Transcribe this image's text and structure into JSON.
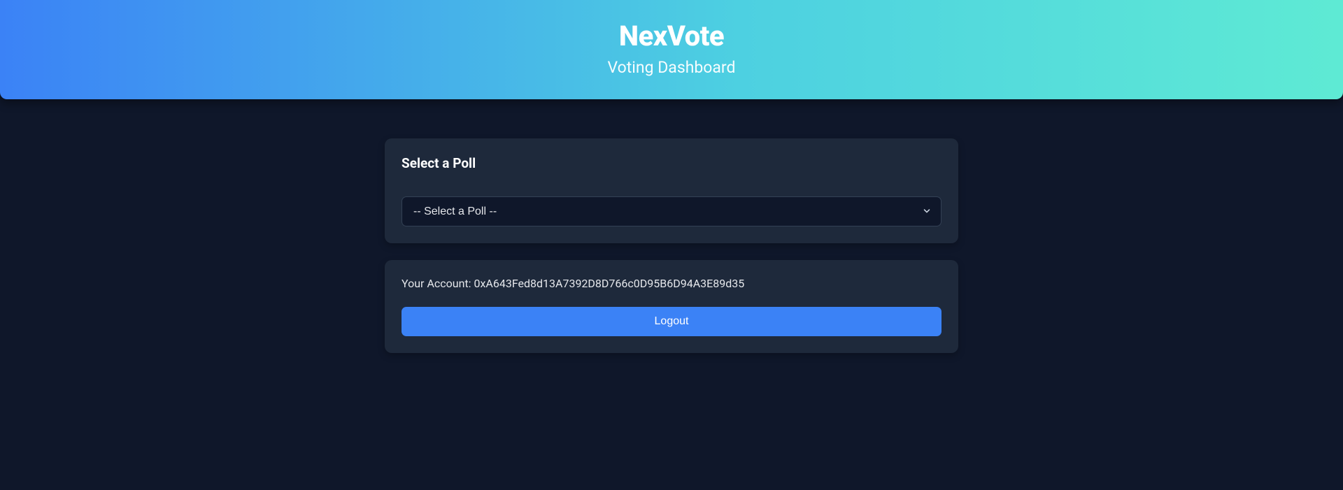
{
  "header": {
    "title": "NexVote",
    "subtitle": "Voting Dashboard"
  },
  "poll_card": {
    "title": "Select a Poll",
    "select_placeholder": "-- Select a Poll --"
  },
  "account_card": {
    "label_prefix": "Your Account: ",
    "address": "0xA643Fed8d13A7392D8D766c0D95B6D94A3E89d35",
    "logout_label": "Logout"
  }
}
